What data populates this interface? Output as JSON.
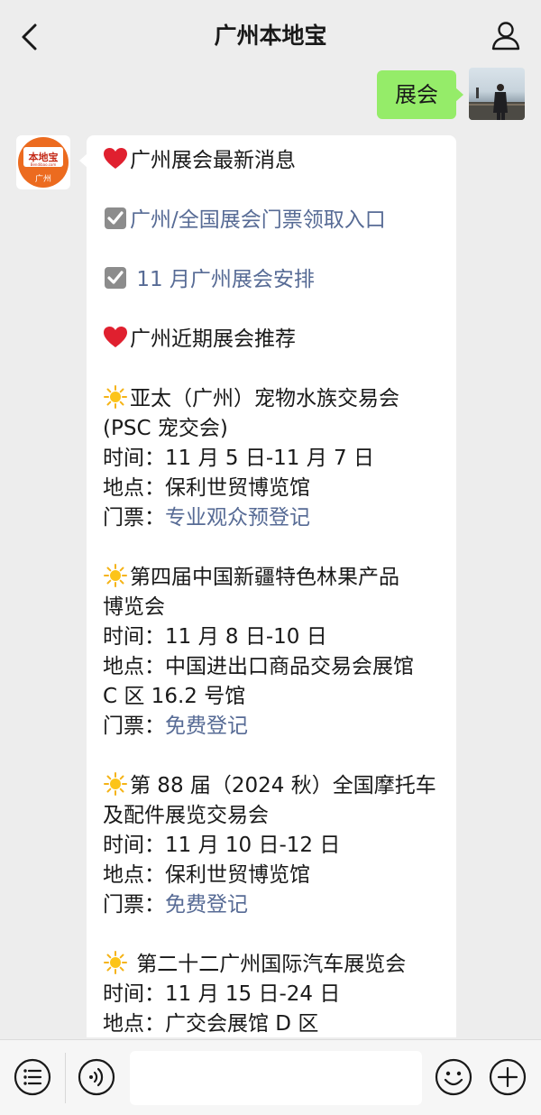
{
  "header": {
    "title": "广州本地宝",
    "back_icon": "chevron-left-icon",
    "profile_icon": "person-icon"
  },
  "outgoing": {
    "text": "展会"
  },
  "avatar_logo": {
    "brand": "本地宝",
    "domain": "Bendibao.com",
    "city": "广州"
  },
  "message": {
    "h1": "广州展会最新消息",
    "link1": "广州/全国展会门票领取入口",
    "link2": "11 月广州展会安排",
    "h2": "广州近期展会推荐",
    "events": [
      {
        "title_l1": "亚太（广州）宠物水族交易会",
        "title_l2": "(PSC 宠交会)",
        "time_label": "时间：",
        "time": "11 月 5 日-11 月 7 日",
        "place_label": "地点：",
        "place_l1": "保利世贸博览馆",
        "ticket_label": "门票：",
        "ticket": "专业观众预登记"
      },
      {
        "title_l1": "第四届中国新疆特色林果产品",
        "title_l2": "博览会",
        "time_label": "时间：",
        "time": "11 月 8 日-10 日",
        "place_label": "地点：",
        "place_l1": "中国进出口商品交易会展馆",
        "place_l2": "C 区 16.2 号馆",
        "ticket_label": "门票：",
        "ticket": "免费登记"
      },
      {
        "title_l1": "第 88 届（2024 秋）全国摩托车",
        "title_l2": "及配件展览交易会",
        "time_label": "时间：",
        "time": "11 月 10 日-12 日",
        "place_label": "地点：",
        "place_l1": "保利世贸博览馆",
        "ticket_label": "门票：",
        "ticket": "免费登记"
      },
      {
        "title_l1": " 第二十二广州国际汽车展览会",
        "time_label": "时间：",
        "time": "11 月 15 日-24 日",
        "place_label": "地点：",
        "place_l1": "广交会展馆 D 区"
      }
    ]
  },
  "bottombar": {
    "icons": [
      "menu-icon",
      "voice-icon",
      "emoji-icon",
      "plus-icon"
    ]
  },
  "colors": {
    "background": "#ededed",
    "bubble_out": "#95ec69",
    "bubble_in": "#ffffff",
    "link": "#576b95"
  }
}
